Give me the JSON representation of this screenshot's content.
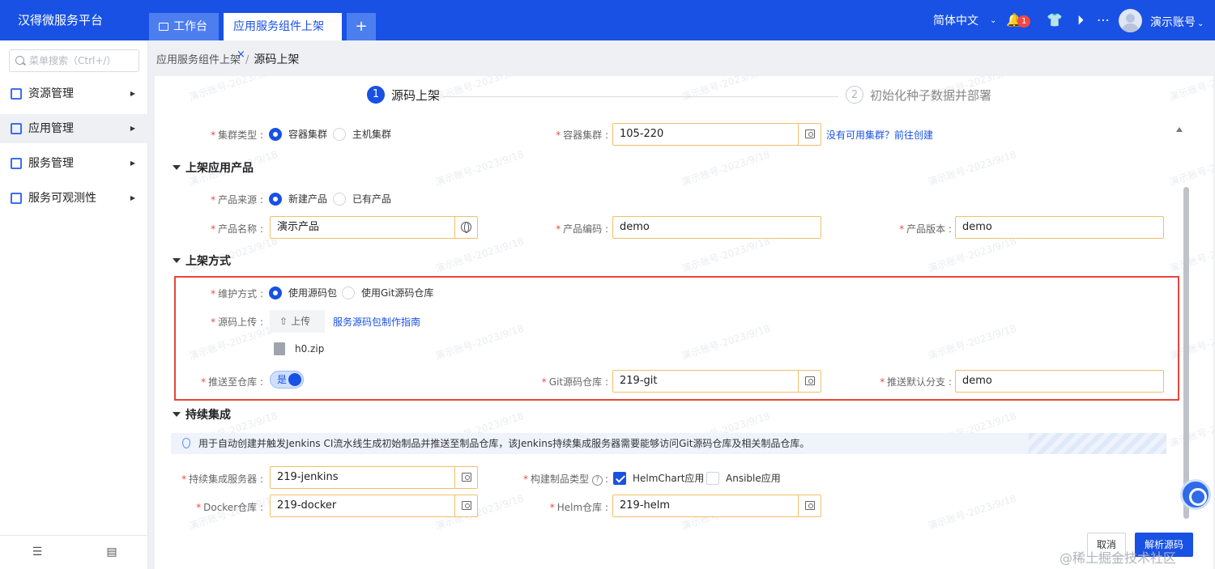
{
  "app": {
    "title": "汉得微服务平台"
  },
  "tabs": [
    {
      "label": "工作台"
    },
    {
      "label": "应用服务组件上架",
      "close": "×"
    },
    {
      "label": "+"
    }
  ],
  "header": {
    "language": "简体中文",
    "notification_count": "1",
    "username": "演示账号",
    "icons": [
      "bell-icon",
      "shirt-icon",
      "play-icon",
      "more-icon"
    ]
  },
  "sidebar": {
    "search_placeholder": "菜单搜索（Ctrl+/）",
    "items": [
      {
        "label": "资源管理"
      },
      {
        "label": "应用管理"
      },
      {
        "label": "服务管理"
      },
      {
        "label": "服务可观测性"
      }
    ]
  },
  "breadcrumb": {
    "parent": "应用服务组件上架",
    "current": "源码上架"
  },
  "steps": [
    {
      "num": "1",
      "label": "源码上架"
    },
    {
      "num": "2",
      "label": "初始化种子数据并部署"
    }
  ],
  "form": {
    "cluster_type_label": "集群类型 :",
    "cluster_options": [
      "容器集群",
      "主机集群"
    ],
    "container_cluster_label": "容器集群 :",
    "container_cluster_value": "105-220",
    "create_cluster_link": "没有可用集群？前往创建",
    "section_product": "上架应用产品",
    "product_source_label": "产品来源 :",
    "product_source_options": [
      "新建产品",
      "已有产品"
    ],
    "product_name_label": "产品名称 :",
    "product_name_value": "演示产品",
    "product_code_label": "产品编码 :",
    "product_code_value": "demo",
    "product_version_label": "产品版本 :",
    "product_version_value": "demo",
    "section_method": "上架方式",
    "maintain_label": "维护方式 :",
    "maintain_options": [
      "使用源码包",
      "使用Git源码仓库"
    ],
    "upload_label": "源码上传 :",
    "upload_button": "上传",
    "upload_guide_link": "服务源码包制作指南",
    "uploaded_file": "h0.zip",
    "push_label": "推送至仓库 :",
    "push_switch": "是",
    "git_repo_label": "Git源码仓库 :",
    "git_repo_value": "219-git",
    "default_branch_label": "推送默认分支 :",
    "default_branch_value": "demo",
    "section_ci": "持续集成",
    "ci_info": "用于自动创建并触发Jenkins CI流水线生成初始制品并推送至制品仓库，该Jenkins持续集成服务器需要能够访问Git源码仓库及相关制品仓库。",
    "ci_server_label": "持续集成服务器 :",
    "ci_server_value": "219-jenkins",
    "artifact_type_label": "构建制品类型",
    "artifact_options": [
      "HelmChart应用",
      "Ansible应用"
    ],
    "docker_repo_label": "Docker仓库 :",
    "docker_repo_value": "219-docker",
    "helm_repo_label": "Helm仓库 :",
    "helm_repo_value": "219-helm"
  },
  "actions": {
    "cancel": "取消",
    "parse": "解析源码"
  },
  "watermark": "演示账号-2023/9/18",
  "footer_watermark": "@稀土掘金技术社区",
  "colors": {
    "primary": "#1851e3",
    "highlight_border": "#e8453c",
    "required": "#f04848"
  }
}
